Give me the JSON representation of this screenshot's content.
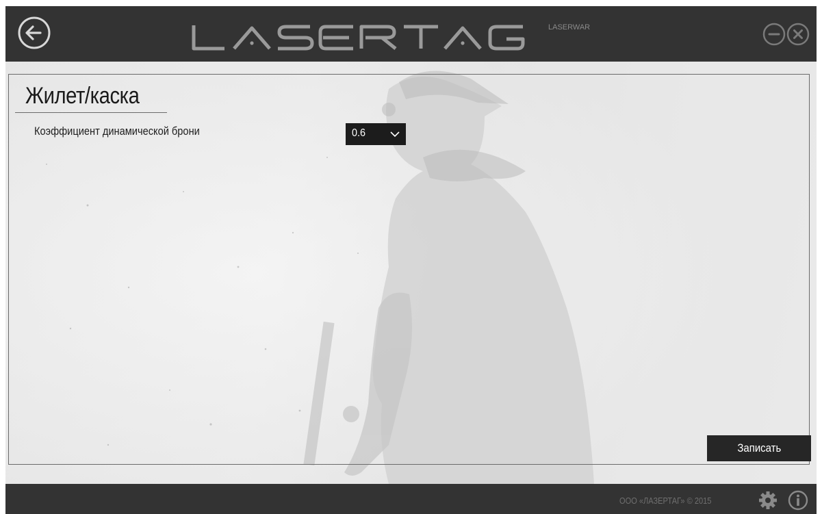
{
  "header": {
    "logo_text": "LASERTAG",
    "logo_subtext": "LASERWAR",
    "back_icon": "back-arrow-icon",
    "minimize_icon": "minimize-icon",
    "close_icon": "close-icon"
  },
  "panel": {
    "title": "Жилет/каска",
    "fields": [
      {
        "label": "Коэффициент динамической брони",
        "value": "0.6"
      }
    ],
    "save_label": "Записать"
  },
  "footer": {
    "copyright": "ООО «ЛАЗЕРТАГ» © 2015",
    "settings_icon": "gear-icon",
    "info_icon": "info-icon"
  },
  "colors": {
    "titlebar": "#333333",
    "footer": "#333333",
    "select_bg": "#1c1c1c",
    "button_bg": "#262626",
    "logo": "#9a9a9a"
  }
}
